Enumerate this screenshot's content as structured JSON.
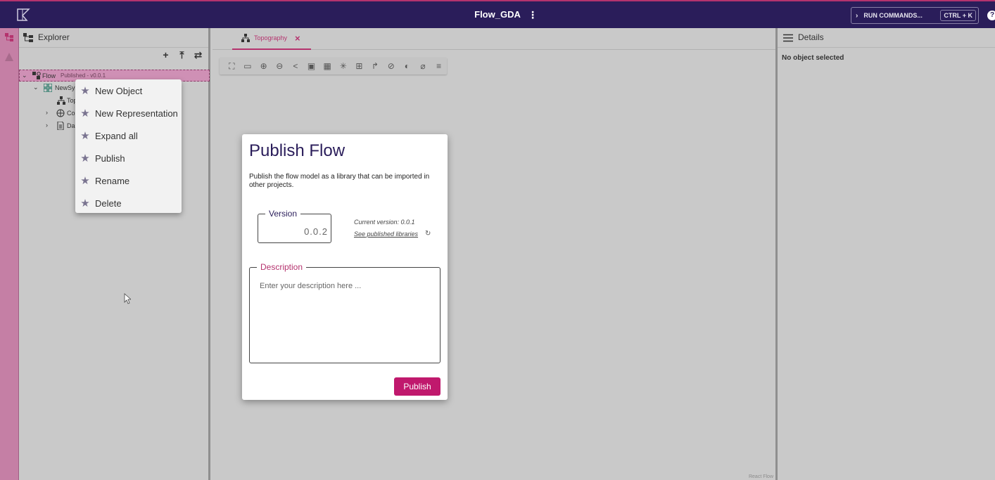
{
  "header": {
    "title": "Flow_GDA",
    "run_commands_label": "RUN COMMANDS...",
    "run_commands_shortcut": "CTRL + K",
    "help_symbol": "?",
    "logo_icon": "flow-logo-icon"
  },
  "explorer": {
    "title": "Explorer",
    "tools": [
      "+",
      "⤒",
      "⇄"
    ],
    "tree": {
      "root_label": "Flow",
      "root_meta": "Published - v0.0.1",
      "child_label": "NewSy",
      "grandchild_label": "Top",
      "item_co": "Co",
      "item_da": "Da"
    }
  },
  "context_menu": {
    "items": [
      "New Object",
      "New Representation",
      "Expand all",
      "Publish",
      "Rename",
      "Delete"
    ]
  },
  "editor": {
    "tab_label": "Topography",
    "watermark": "React Flow"
  },
  "modal": {
    "title": "Publish Flow",
    "description": "Publish the flow model as a library that can be imported in other projects.",
    "version_label": "Version",
    "version_value": "0.0.2",
    "current_version": "Current version: 0.0.1",
    "see_libraries": "See published libraries",
    "description_label": "Description",
    "description_placeholder": "Enter your description here ...",
    "publish_label": "Publish"
  },
  "details": {
    "title": "Details",
    "empty_text": "No object selected"
  },
  "colors": {
    "header_bg": "#2a1d5a",
    "accent": "#c0196d",
    "rail": "#c57fa5",
    "selection": "#cf90b5"
  }
}
